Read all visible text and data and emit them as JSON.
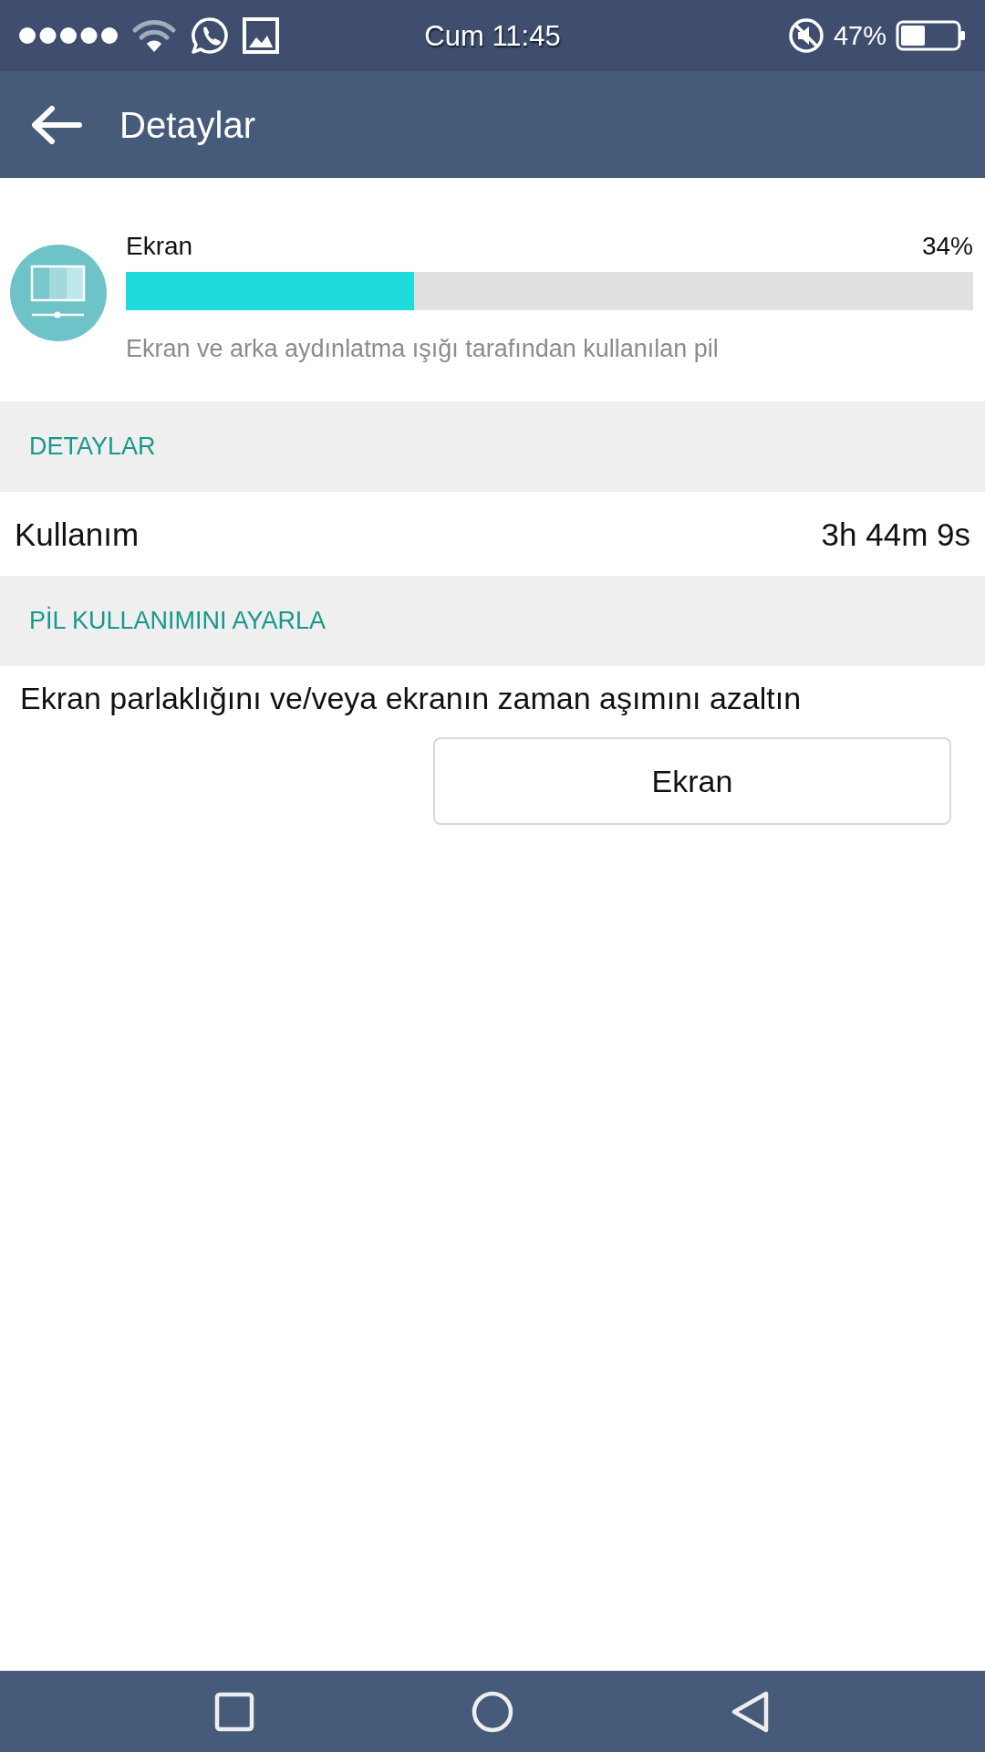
{
  "status_bar": {
    "time": "Cum 11:45",
    "battery_percent": "47%"
  },
  "app_bar": {
    "title": "Detaylar"
  },
  "usage_item": {
    "name": "Ekran",
    "percent": "34%",
    "level": 0.34,
    "description": "Ekran ve arka aydınlatma ışığı tarafından kullanılan pil"
  },
  "sections": [
    {
      "header": "DETAYLAR",
      "rows": [
        {
          "kind": "value",
          "label": "Kullanım",
          "value": "3h 44m 9s"
        }
      ]
    },
    {
      "header": "PİL KULLANIMINI AYARLA",
      "rows": [
        {
          "kind": "action",
          "label": "Ekran parlaklığını ve/veya ekranın zaman aşımını azaltın",
          "button": "Ekran"
        }
      ]
    }
  ]
}
